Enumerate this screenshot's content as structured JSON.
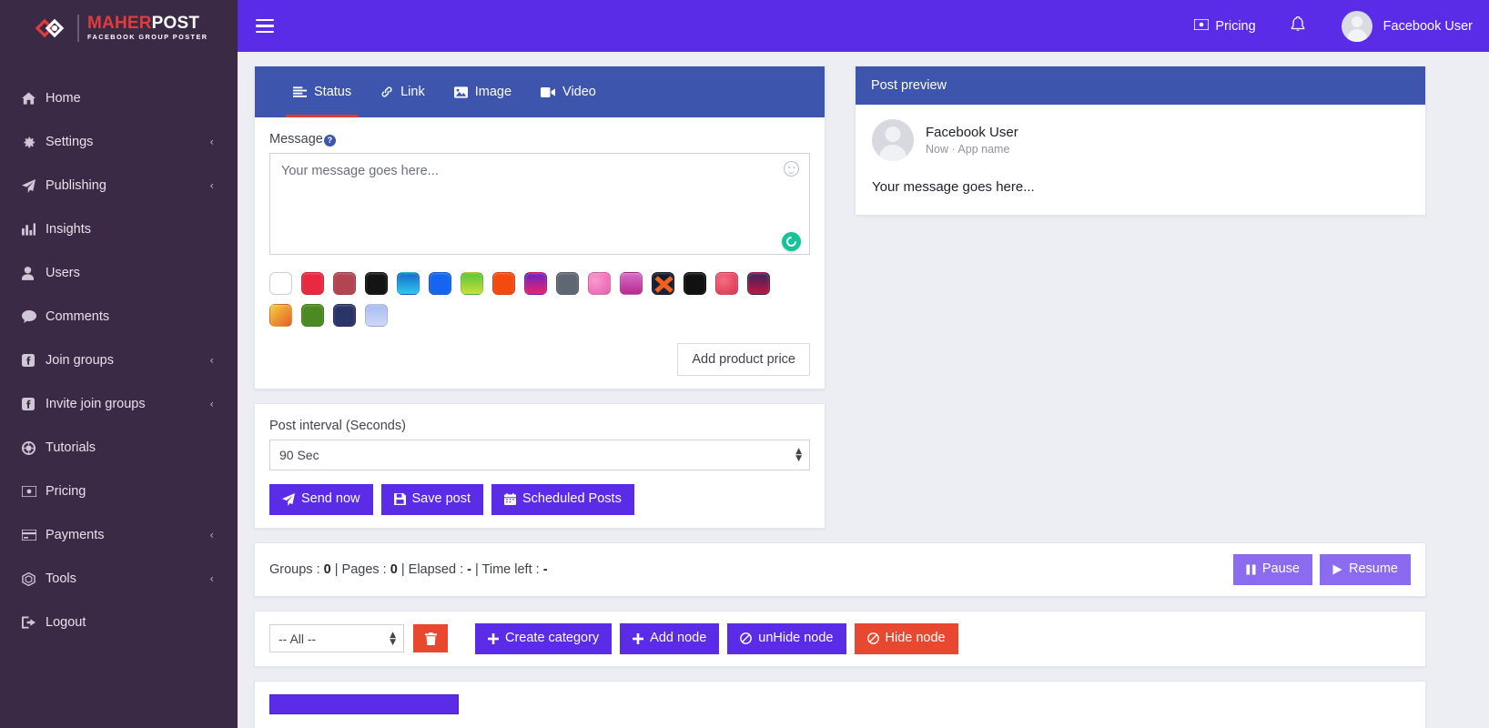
{
  "brand": {
    "title_part1": "MAHER",
    "title_part2": "POST",
    "subtitle": "FACEBOOK GROUP POSTER"
  },
  "sidebar": {
    "items": [
      {
        "label": "Home",
        "icon": "home-icon",
        "caret": ""
      },
      {
        "label": "Settings",
        "icon": "gear-icon",
        "caret": "‹"
      },
      {
        "label": "Publishing",
        "icon": "paper-plane-icon",
        "caret": "‹"
      },
      {
        "label": "Insights",
        "icon": "bar-chart-icon",
        "caret": ""
      },
      {
        "label": "Users",
        "icon": "user-icon",
        "caret": ""
      },
      {
        "label": "Comments",
        "icon": "comment-icon",
        "caret": ""
      },
      {
        "label": "Join groups",
        "icon": "facebook-icon",
        "caret": "‹"
      },
      {
        "label": "Invite join groups",
        "icon": "facebook-icon",
        "caret": "‹"
      },
      {
        "label": "Tutorials",
        "icon": "life-ring-icon",
        "caret": ""
      },
      {
        "label": "Pricing",
        "icon": "money-bill-icon",
        "caret": ""
      },
      {
        "label": "Payments",
        "icon": "credit-card-icon",
        "caret": "‹"
      },
      {
        "label": "Tools",
        "icon": "cubes-icon",
        "caret": "‹"
      },
      {
        "label": "Logout",
        "icon": "sign-out-icon",
        "caret": ""
      }
    ]
  },
  "topbar": {
    "menu_toggle": "hamburger-icon",
    "pricing_label": "Pricing",
    "bell": "🔔",
    "user_name": "Facebook User"
  },
  "composer": {
    "tabs": [
      {
        "label": "Status",
        "icon": "list-icon",
        "active": true
      },
      {
        "label": "Link",
        "icon": "link-icon",
        "active": false
      },
      {
        "label": "Image",
        "icon": "image-icon",
        "active": false
      },
      {
        "label": "Video",
        "icon": "video-icon",
        "active": false
      }
    ],
    "message_label": "Message",
    "help_glyph": "?",
    "message_placeholder": "Your message goes here...",
    "message_value": "",
    "emoji_icon": "smiley-icon",
    "grammarly_icon": "grammarly-icon",
    "add_price_label": "Add product price",
    "swatches": [
      "#ffffff",
      "#e8293f",
      "#b24552",
      "#141414",
      "#27a8e0",
      "#1565f0",
      "#6fc22b",
      "#f44a12",
      "#b81e8e",
      "#5f6773",
      "#ee6bb6",
      "#c44aa8",
      "#1b1f2e",
      "#111111",
      "#e8465e",
      "#8d1038",
      "#e8c33a",
      "#4b8a22",
      "#2b3468",
      "#a9bcf0"
    ]
  },
  "interval": {
    "label": "Post interval (Seconds)",
    "selected": "90 Sec",
    "options": [
      "90 Sec"
    ],
    "buttons": [
      {
        "label": "Send now",
        "icon": "paper-plane-icon",
        "style": "purple"
      },
      {
        "label": "Save post",
        "icon": "floppy-disk-icon",
        "style": "purple"
      },
      {
        "label": "Scheduled Posts",
        "icon": "calendar-icon",
        "style": "purple"
      }
    ]
  },
  "status_bar": {
    "groups_label": "Groups : ",
    "groups_value": "0",
    "pages_label": " | Pages : ",
    "pages_value": "0",
    "elapsed_label": " | Elapsed : ",
    "elapsed_value": "-",
    "timeleft_label": " | Time left : ",
    "timeleft_value": "-",
    "pause_label": "Pause",
    "resume_label": "Resume"
  },
  "node_toolbar": {
    "category_selected": "-- All --",
    "category_options": [
      "-- All --"
    ],
    "delete_icon": "trash-icon",
    "buttons": [
      {
        "label": "Create category",
        "icon": "plus-icon",
        "style": "purple"
      },
      {
        "label": "Add node",
        "icon": "plus-icon",
        "style": "purple"
      },
      {
        "label": "unHide node",
        "icon": "ban-icon",
        "style": "purple"
      },
      {
        "label": "Hide node",
        "icon": "ban-icon",
        "style": "red"
      }
    ]
  },
  "post_preview": {
    "header": "Post preview",
    "user_name": "Facebook User",
    "meta": "Now · App name",
    "message": "Your message goes here..."
  },
  "colors": {
    "sidebar_bg": "#3b2a46",
    "topbar_purple": "#5b2ce8",
    "card_header_blue": "#3d55ac",
    "accent_red": "#e03a2f",
    "danger_red": "#e8482f",
    "page_bg": "#eceef3"
  }
}
